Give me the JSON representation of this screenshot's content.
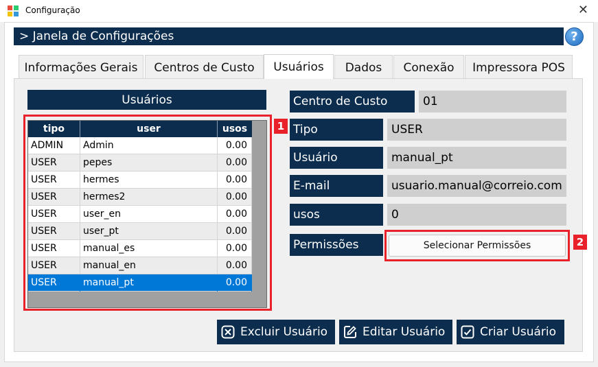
{
  "window": {
    "title": "Configuração",
    "close_glyph": "✕",
    "app_icon": "app-logo-icon"
  },
  "header": {
    "title": "> Janela de Configurações",
    "help_glyph": "?"
  },
  "tabs": [
    {
      "label": "Informações Gerais"
    },
    {
      "label": "Centros de Custo"
    },
    {
      "label": "Usuários",
      "active": true
    },
    {
      "label": "Dados"
    },
    {
      "label": "Conexão"
    },
    {
      "label": "Impressora POS"
    }
  ],
  "users_panel": {
    "title": "Usuários",
    "columns": [
      "tipo",
      "user",
      "usos"
    ],
    "rows": [
      {
        "tipo": "ADMIN",
        "user": "Admin",
        "usos": "0.00"
      },
      {
        "tipo": "USER",
        "user": "pepes",
        "usos": "0.00"
      },
      {
        "tipo": "USER",
        "user": "hermes",
        "usos": "0.00"
      },
      {
        "tipo": "USER",
        "user": "hermes2",
        "usos": "0.00"
      },
      {
        "tipo": "USER",
        "user": "user_en",
        "usos": "0.00"
      },
      {
        "tipo": "USER",
        "user": "user_pt",
        "usos": "0.00"
      },
      {
        "tipo": "USER",
        "user": "manual_es",
        "usos": "0.00"
      },
      {
        "tipo": "USER",
        "user": "manual_en",
        "usos": "0.00"
      },
      {
        "tipo": "USER",
        "user": "manual_pt",
        "usos": "0.00",
        "selected": true
      }
    ]
  },
  "form": {
    "centro_label": "Centro de Custo",
    "centro_value": "01",
    "tipo_label": "Tipo",
    "tipo_value": "USER",
    "usuario_label": "Usuário",
    "usuario_value": "manual_pt",
    "email_label": "E-mail",
    "email_value": "usuario.manual@correio.com",
    "usos_label": "usos",
    "usos_value": "0",
    "permissoes_label": "Permissões",
    "permissoes_button": "Selecionar Permissões"
  },
  "actions": {
    "delete": "Excluir Usuário",
    "edit": "Editar Usuário",
    "create": "Criar Usuário"
  },
  "callouts": {
    "one": "1",
    "two": "2"
  },
  "colors": {
    "navy": "#0d2d4e",
    "selected_row": "#0078d7",
    "callout_red": "#e8212b",
    "value_bg": "#cfcfcf"
  }
}
